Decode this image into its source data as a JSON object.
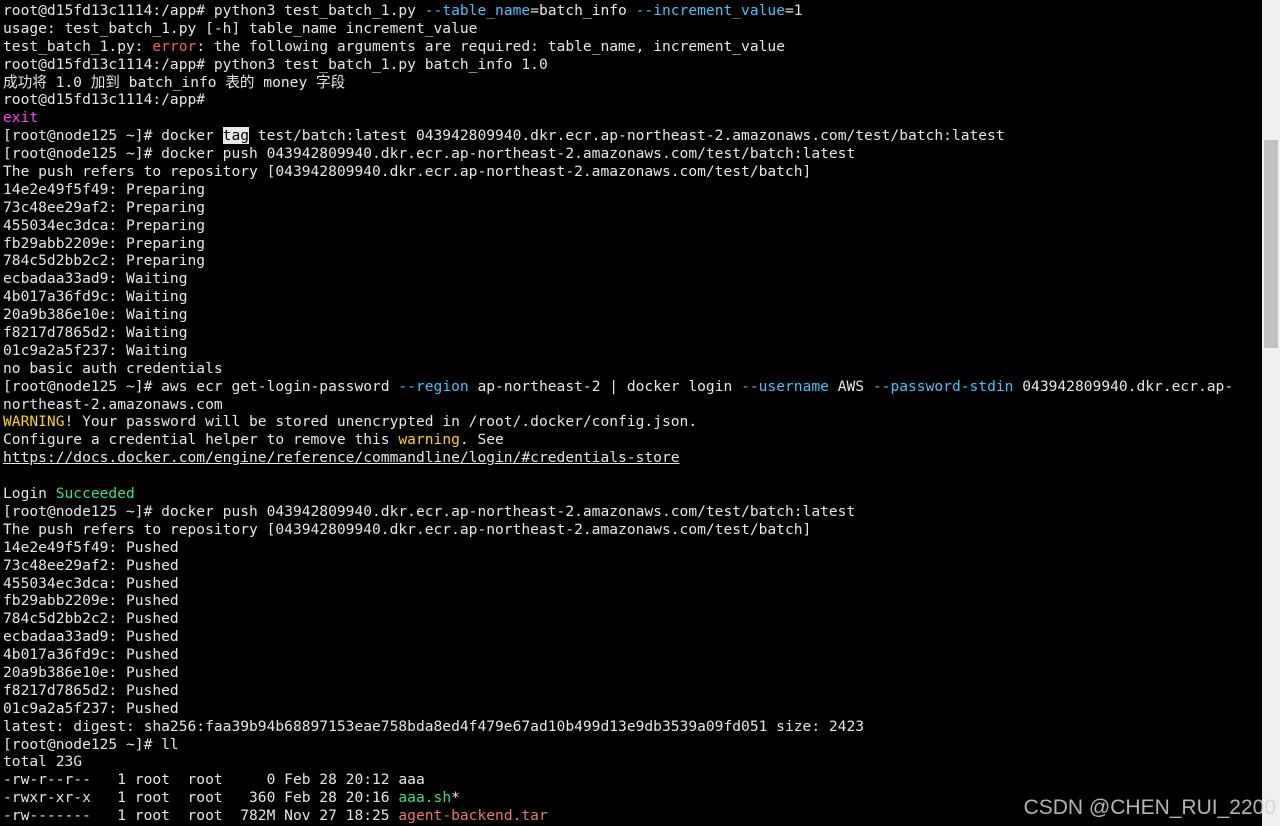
{
  "terminal": {
    "colors": {
      "background": "#000000",
      "text": "#e6e6e6",
      "option_blue": "#3fc3ff",
      "error_red": "#ff5c5c",
      "exit_magenta": "#ff3cff",
      "warning_yellow": "#ffd500",
      "success_green": "#3ee07a",
      "archive_salmon": "#f07470",
      "highlight_bg": "#e8e8e8"
    },
    "lines": [
      [
        {
          "t": "root@d15fd13c1114:/app# python3 test_batch_1.py "
        },
        {
          "t": "--table_name",
          "c": "blue"
        },
        {
          "t": "=batch_info "
        },
        {
          "t": "--increment_value",
          "c": "blue"
        },
        {
          "t": "=1"
        }
      ],
      [
        {
          "t": "usage: test_batch_1.py [-h] table_name increment_value"
        }
      ],
      [
        {
          "t": "test_batch_1.py: "
        },
        {
          "t": "error",
          "c": "red"
        },
        {
          "t": ": the following arguments are required: table_name, increment_value"
        }
      ],
      [
        {
          "t": "root@d15fd13c1114:/app# python3 test_batch_1.py batch_info 1.0"
        }
      ],
      [
        {
          "t": "成功将 1.0 加到 batch_info 表的 money 字段"
        }
      ],
      [
        {
          "t": "root@d15fd13c1114:/app#"
        }
      ],
      [
        {
          "t": "exit",
          "c": "magenta"
        }
      ],
      [
        {
          "t": "[root@node125 ~]# docker "
        },
        {
          "t": "tag",
          "c": "hl"
        },
        {
          "t": " test/batch:latest 043942809940.dkr.ecr.ap-northeast-2.amazonaws.com/test/batch:latest"
        }
      ],
      [
        {
          "t": "[root@node125 ~]# docker push 043942809940.dkr.ecr.ap-northeast-2.amazonaws.com/test/batch:latest"
        }
      ],
      [
        {
          "t": "The push refers to repository [043942809940.dkr.ecr.ap-northeast-2.amazonaws.com/test/batch]"
        }
      ],
      [
        {
          "t": "14e2e49f5f49: Preparing"
        }
      ],
      [
        {
          "t": "73c48ee29af2: Preparing"
        }
      ],
      [
        {
          "t": "455034ec3dca: Preparing"
        }
      ],
      [
        {
          "t": "fb29abb2209e: Preparing"
        }
      ],
      [
        {
          "t": "784c5d2bb2c2: Preparing"
        }
      ],
      [
        {
          "t": "ecbadaa33ad9: Waiting"
        }
      ],
      [
        {
          "t": "4b017a36fd9c: Waiting"
        }
      ],
      [
        {
          "t": "20a9b386e10e: Waiting"
        }
      ],
      [
        {
          "t": "f8217d7865d2: Waiting"
        }
      ],
      [
        {
          "t": "01c9a2a5f237: Waiting"
        }
      ],
      [
        {
          "t": "no basic auth credentials"
        }
      ],
      [
        {
          "t": "[root@node125 ~]# aws ecr get-login-password "
        },
        {
          "t": "--region",
          "c": "blue"
        },
        {
          "t": " ap-northeast-2 | docker login "
        },
        {
          "t": "--username",
          "c": "blue"
        },
        {
          "t": " AWS "
        },
        {
          "t": "--password-stdin",
          "c": "blue"
        },
        {
          "t": " 043942809940.dkr.ecr.ap-"
        }
      ],
      [
        {
          "t": "northeast-2.amazonaws.com"
        }
      ],
      [
        {
          "t": "WARNING",
          "c": "yellow"
        },
        {
          "t": "! Your password will be stored unencrypted in /root/.docker/config.json."
        }
      ],
      [
        {
          "t": "Configure a credential helper to remove this "
        },
        {
          "t": "warning",
          "c": "yellow"
        },
        {
          "t": ". See"
        }
      ],
      [
        {
          "t": "https://docs.docker.com/engine/reference/commandline/login/#credentials-store",
          "c": "link"
        }
      ],
      [],
      [
        {
          "t": "Login "
        },
        {
          "t": "Succeeded",
          "c": "green"
        }
      ],
      [
        {
          "t": "[root@node125 ~]# docker push 043942809940.dkr.ecr.ap-northeast-2.amazonaws.com/test/batch:latest"
        }
      ],
      [
        {
          "t": "The push refers to repository [043942809940.dkr.ecr.ap-northeast-2.amazonaws.com/test/batch]"
        }
      ],
      [
        {
          "t": "14e2e49f5f49: Pushed"
        }
      ],
      [
        {
          "t": "73c48ee29af2: Pushed"
        }
      ],
      [
        {
          "t": "455034ec3dca: Pushed"
        }
      ],
      [
        {
          "t": "fb29abb2209e: Pushed"
        }
      ],
      [
        {
          "t": "784c5d2bb2c2: Pushed"
        }
      ],
      [
        {
          "t": "ecbadaa33ad9: Pushed"
        }
      ],
      [
        {
          "t": "4b017a36fd9c: Pushed"
        }
      ],
      [
        {
          "t": "20a9b386e10e: Pushed"
        }
      ],
      [
        {
          "t": "f8217d7865d2: Pushed"
        }
      ],
      [
        {
          "t": "01c9a2a5f237: Pushed"
        }
      ],
      [
        {
          "t": "latest: digest: sha256:faa39b94b68897153eae758bda8ed4f479e67ad10b499d13e9db3539a09fd051 size: 2423"
        }
      ],
      [
        {
          "t": "[root@node125 ~]# ll"
        }
      ],
      [
        {
          "t": "total 23G"
        }
      ],
      [
        {
          "t": "-rw-r--r--   1 root  root     0 Feb 28 20:12 aaa"
        }
      ],
      [
        {
          "t": "-rwxr-xr-x   1 root  root   360 Feb 28 20:16 "
        },
        {
          "t": "aaa.sh",
          "c": "green"
        },
        {
          "t": "*"
        }
      ],
      [
        {
          "t": "-rw-------   1 root  root  782M Nov 27 18:25 "
        },
        {
          "t": "agent-backend.tar",
          "c": "salmon"
        }
      ]
    ]
  },
  "scrollbar": {
    "position": 0.17
  },
  "watermark": {
    "text": "CSDN @CHEN_RUI_2200"
  }
}
